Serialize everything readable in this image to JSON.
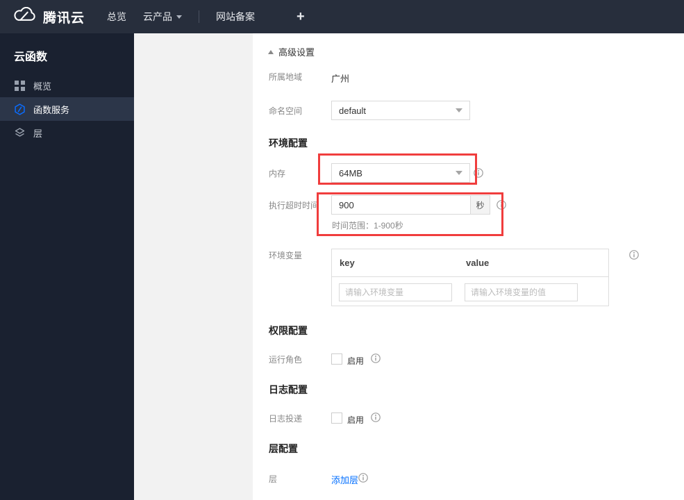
{
  "topbar": {
    "brand": "腾讯云",
    "nav_overview": "总览",
    "nav_products": "云产品",
    "nav_beian": "网站备案",
    "nav_plus": "+"
  },
  "sidebar": {
    "title": "云函数",
    "items": [
      {
        "label": "概览",
        "icon": "grid-icon",
        "selected": false
      },
      {
        "label": "函数服务",
        "icon": "function-hexagon-icon",
        "selected": true
      },
      {
        "label": "层",
        "icon": "layers-icon",
        "selected": false
      }
    ]
  },
  "content": {
    "advanced_settings": "高级设置",
    "region_label": "所属地域",
    "region_value": "广州",
    "namespace_label": "命名空间",
    "namespace_value": "default",
    "env_section_title": "环境配置",
    "memory_label": "内存",
    "memory_value": "64MB",
    "timeout_label": "执行超时时间",
    "timeout_value": "900",
    "timeout_unit": "秒",
    "timeout_hint": "时间范围：1-900秒",
    "envvar_label": "环境变量",
    "envvar_key_header": "key",
    "envvar_value_header": "value",
    "envvar_key_placeholder": "请输入环境变量",
    "envvar_value_placeholder": "请输入环境变量的值",
    "perm_section_title": "权限配置",
    "role_label": "运行角色",
    "role_enable_label": "启用",
    "log_section_title": "日志配置",
    "log_label": "日志投递",
    "log_enable_label": "启用",
    "layer_section_title": "层配置",
    "layer_label": "层",
    "layer_add_link": "添加层"
  },
  "colors": {
    "highlight_red": "#f03d3d",
    "link_blue": "#006eff",
    "topbar_bg": "#272e3c",
    "sidebar_bg": "#1a2130",
    "sidebar_selected_bg": "#2c3649",
    "panel_gray": "#f2f2f2"
  }
}
